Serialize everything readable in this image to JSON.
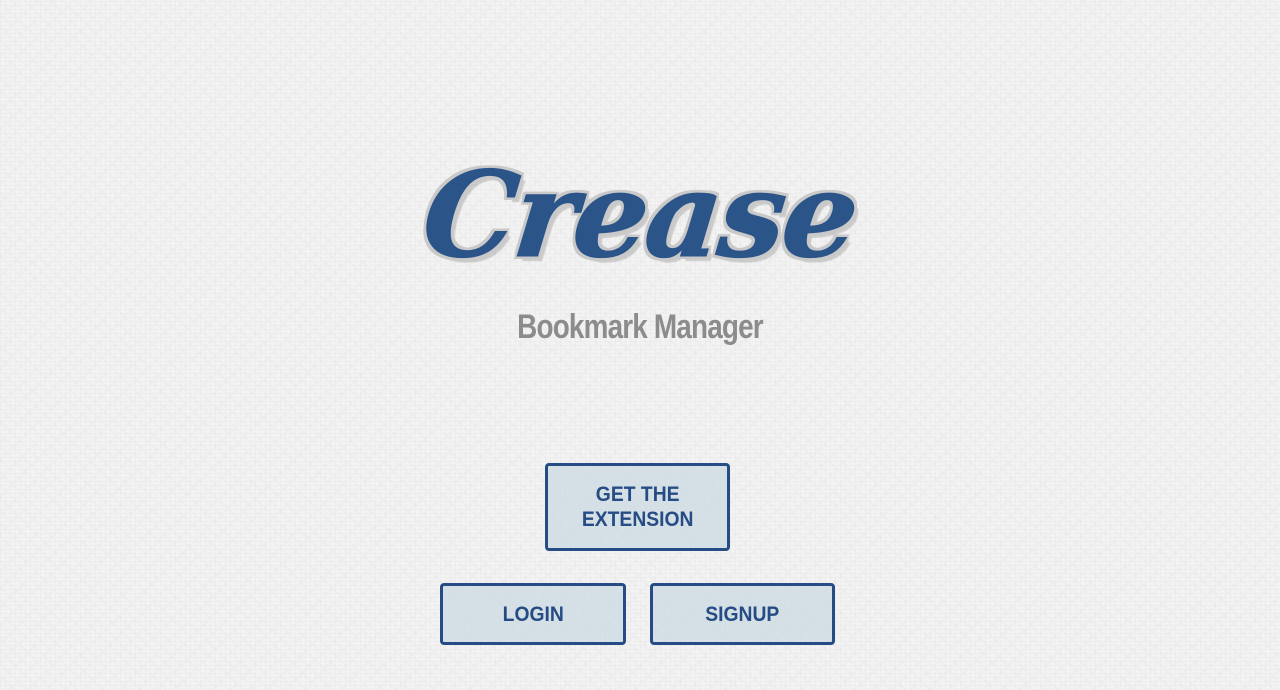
{
  "brand": {
    "logo_text": "Crease",
    "subtitle": "Bookmark Manager"
  },
  "actions": {
    "extension_label": "GET THE\nEXTENSION",
    "login_label": "LOGIN",
    "signup_label": "SIGNUP"
  },
  "colors": {
    "primary": "#2b5489",
    "button_border": "#254c84",
    "subtitle": "#8c8c8c",
    "button_fill": "#cddbe3",
    "background": "#f3f3f3"
  }
}
